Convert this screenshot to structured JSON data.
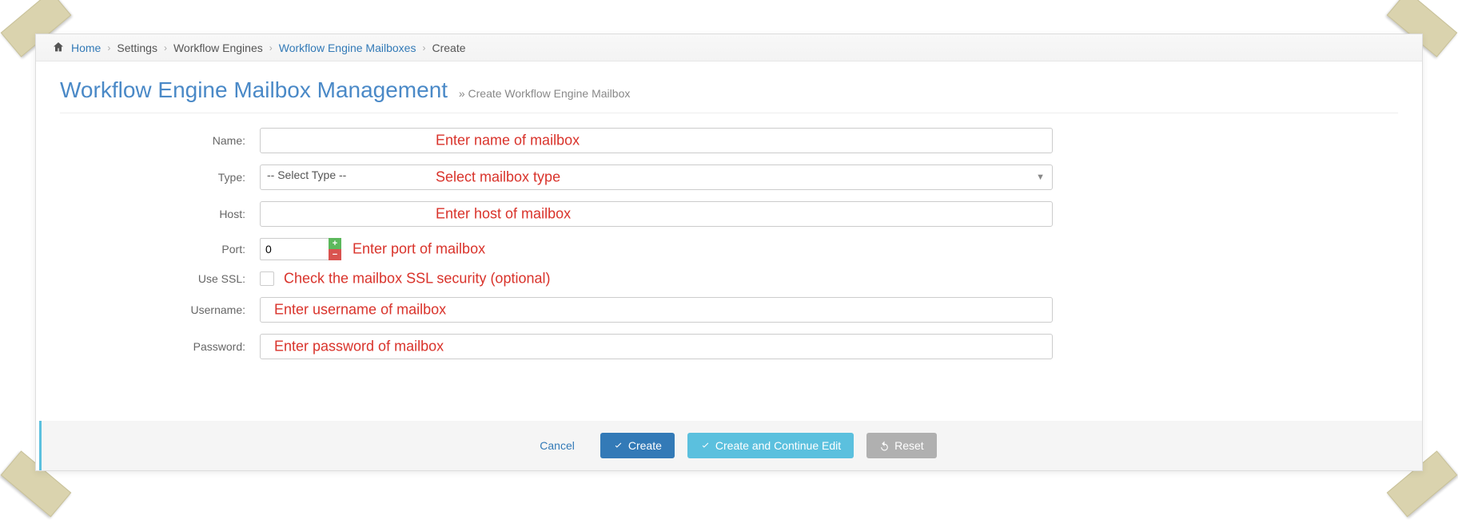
{
  "breadcrumb": [
    "Home",
    "Settings",
    "Workflow Engines",
    "Workflow Engine Mailboxes",
    "Create"
  ],
  "header": {
    "title": "Workflow Engine Mailbox Management",
    "subtitle": "» Create Workflow Engine Mailbox"
  },
  "form": {
    "name": {
      "label": "Name:",
      "value": "",
      "annotation": "Enter name of mailbox"
    },
    "type": {
      "label": "Type:",
      "selected": "-- Select Type --",
      "annotation": "Select mailbox type"
    },
    "host": {
      "label": "Host:",
      "value": "",
      "annotation": "Enter host of mailbox"
    },
    "port": {
      "label": "Port:",
      "value": "0",
      "annotation": "Enter port of mailbox"
    },
    "ssl": {
      "label": "Use SSL:",
      "checked": false,
      "annotation": "Check the mailbox SSL security (optional)"
    },
    "username": {
      "label": "Username:",
      "value": "",
      "annotation": "Enter username of mailbox"
    },
    "password": {
      "label": "Password:",
      "value": "",
      "annotation": "Enter password of mailbox"
    }
  },
  "actions": {
    "cancel": "Cancel",
    "create": "Create",
    "create_continue": "Create and Continue Edit",
    "reset": "Reset"
  }
}
